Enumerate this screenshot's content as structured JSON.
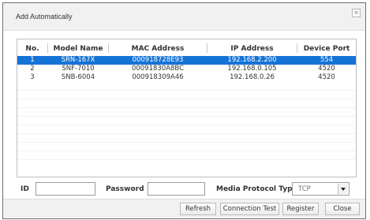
{
  "dialog": {
    "title": "Add Automatically",
    "close_glyph": "×"
  },
  "table": {
    "columns": [
      "No.",
      "Model Name",
      "MAC Address",
      "IP Address",
      "Device Port"
    ],
    "rows": [
      {
        "no": "1",
        "model": "SRN-167X",
        "mac": "000918728E93",
        "ip": "192.168.2.200",
        "port": "554",
        "selected": true
      },
      {
        "no": "2",
        "model": "SNF-7010",
        "mac": "00091830A8BC",
        "ip": "192.168.0.105",
        "port": "4520",
        "selected": false
      },
      {
        "no": "3",
        "model": "SNB-6004",
        "mac": "000918309A46",
        "ip": "192.168.0.26",
        "port": "4520",
        "selected": false
      }
    ]
  },
  "form": {
    "id_label": "ID",
    "id_value": "",
    "password_label": "Password",
    "password_value": "",
    "protocol_label": "Media Protocol Type",
    "protocol_value": "TCP"
  },
  "buttons": {
    "refresh": "Refresh",
    "connection_test": "Connection Test",
    "register": "Register",
    "close": "Close"
  },
  "colors": {
    "selection": "#1573d6",
    "titlebar": "#f1f1f1"
  }
}
